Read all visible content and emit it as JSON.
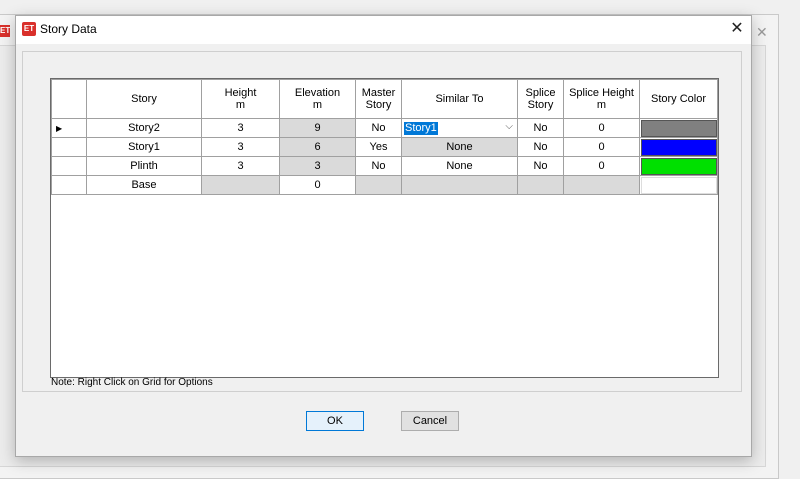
{
  "window": {
    "title": "Story Data",
    "logo": "ET"
  },
  "grid": {
    "headers": {
      "story": "Story",
      "height": [
        "Height",
        "m"
      ],
      "elevation": [
        "Elevation",
        "m"
      ],
      "master": [
        "Master",
        "Story"
      ],
      "similar": "Similar To",
      "splice": [
        "Splice",
        "Story"
      ],
      "splice_height": [
        "Splice Height",
        "m"
      ],
      "color": "Story Color"
    },
    "rows": [
      {
        "story": "Story2",
        "height": "3",
        "elevation": "9",
        "master": "No",
        "similar": "Story1",
        "splice": "No",
        "splice_height": "0",
        "color": "#808080",
        "current": true
      },
      {
        "story": "Story1",
        "height": "3",
        "elevation": "6",
        "master": "Yes",
        "similar": "None",
        "splice": "No",
        "splice_height": "0",
        "color": "#0000ff"
      },
      {
        "story": "Plinth",
        "height": "3",
        "elevation": "3",
        "master": "No",
        "similar": "None",
        "splice": "No",
        "splice_height": "0",
        "color": "#00e000"
      },
      {
        "story": "Base",
        "height": "",
        "elevation": "0",
        "master": "",
        "similar": "",
        "splice": "",
        "splice_height": "",
        "color": "#ffffff"
      }
    ],
    "current_row_marker": "▶"
  },
  "note": "Note:  Right Click on Grid for Options",
  "buttons": {
    "ok": "OK",
    "cancel": "Cancel"
  }
}
